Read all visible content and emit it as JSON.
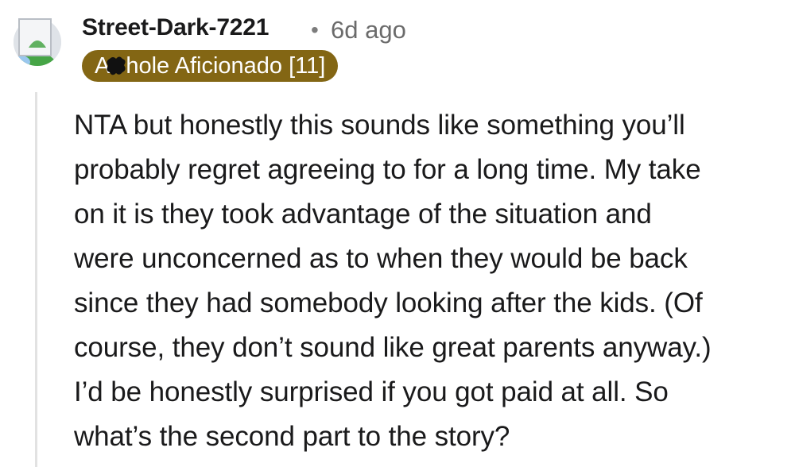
{
  "comment": {
    "author": "Street-Dark-7221",
    "separator": "•",
    "timestamp": "6d ago",
    "flair": {
      "prefix": "A",
      "suffix": "hole Aficionado [11]",
      "background": "#836614",
      "text_color": "#ffffff"
    },
    "avatar_icon": "default-snoo-avatar",
    "body_lines": [
      "NTA but honestly this sounds like something you’ll",
      "probably regret agreeing to for a long time. My take",
      "on it is they took advantage of the situation and",
      "were unconcerned as to when they would be back",
      "since they had somebody looking after the kids. (Of",
      "course, they don’t sound like great parents anyway.)",
      "I’d be honestly surprised if you got paid at all. So",
      "what’s the second part to the story?"
    ]
  }
}
